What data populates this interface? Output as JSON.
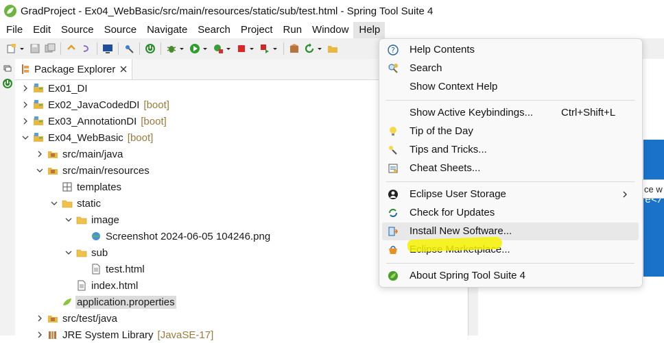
{
  "window": {
    "title": "GradProject - Ex04_WebBasic/src/main/resources/static/sub/test.html - Spring Tool Suite 4"
  },
  "menubar": {
    "items": [
      "File",
      "Edit",
      "Source",
      "Source",
      "Navigate",
      "Search",
      "Project",
      "Run",
      "Window",
      "Help"
    ],
    "active_index": 9
  },
  "explorer": {
    "tab_label": "Package Explorer",
    "rows": [
      {
        "label": "Ex01_DI",
        "deco": "",
        "level": 0,
        "chevron": "right",
        "icon": "project-icon"
      },
      {
        "label": "Ex02_JavaCodedDI",
        "deco": "[boot]",
        "level": 0,
        "chevron": "right",
        "icon": "project-icon"
      },
      {
        "label": "Ex03_AnnotationDI",
        "deco": "[boot]",
        "level": 0,
        "chevron": "right",
        "icon": "project-icon"
      },
      {
        "label": "Ex04_WebBasic",
        "deco": "[boot]",
        "level": 0,
        "chevron": "down",
        "icon": "project-icon"
      },
      {
        "label": "src/main/java",
        "deco": "",
        "level": 1,
        "chevron": "right",
        "icon": "source-folder-icon"
      },
      {
        "label": "src/main/resources",
        "deco": "",
        "level": 1,
        "chevron": "down",
        "icon": "source-folder-icon"
      },
      {
        "label": "templates",
        "deco": "",
        "level": 2,
        "chevron": "none",
        "icon": "package-icon"
      },
      {
        "label": "static",
        "deco": "",
        "level": 2,
        "chevron": "down",
        "icon": "folder-icon"
      },
      {
        "label": "image",
        "deco": "",
        "level": 3,
        "chevron": "down",
        "icon": "folder-icon"
      },
      {
        "label": "Screenshot 2024-06-05 104246.png",
        "deco": "",
        "level": 4,
        "chevron": "none",
        "icon": "image-file-icon"
      },
      {
        "label": "sub",
        "deco": "",
        "level": 3,
        "chevron": "down",
        "icon": "folder-icon"
      },
      {
        "label": "test.html",
        "deco": "",
        "level": 4,
        "chevron": "none",
        "icon": "html-file-icon"
      },
      {
        "label": "index.html",
        "deco": "",
        "level": 3,
        "chevron": "none",
        "icon": "html-file-icon"
      },
      {
        "label": "application.properties",
        "deco": "",
        "level": 2,
        "chevron": "none",
        "icon": "spring-leaf-icon",
        "selected": true
      },
      {
        "label": "src/test/java",
        "deco": "",
        "level": 1,
        "chevron": "right",
        "icon": "source-folder-icon"
      },
      {
        "label": "JRE System Library",
        "deco": "[JavaSE-17]",
        "level": 1,
        "chevron": "right",
        "icon": "library-icon"
      }
    ]
  },
  "editor": {
    "fragment_1": "e</t",
    "hint_fragment": "ce w"
  },
  "help_menu": {
    "items": [
      {
        "label": "Help Contents",
        "shortcut": "",
        "icon": "help-icon"
      },
      {
        "label": "Search",
        "shortcut": "",
        "icon": "search-help-icon"
      },
      {
        "label": "Show Context Help",
        "shortcut": "",
        "icon": ""
      },
      {
        "sep": true
      },
      {
        "label": "Show Active Keybindings...",
        "shortcut": "Ctrl+Shift+L",
        "icon": ""
      },
      {
        "label": "Tip of the Day",
        "shortcut": "",
        "icon": "lightbulb-icon"
      },
      {
        "label": "Tips and Tricks...",
        "shortcut": "",
        "icon": "tips-icon"
      },
      {
        "label": "Cheat Sheets...",
        "shortcut": "",
        "icon": "cheatsheet-icon"
      },
      {
        "sep": true
      },
      {
        "label": "Eclipse User Storage",
        "shortcut": "",
        "icon": "user-icon",
        "submenu": true
      },
      {
        "label": "Check for Updates",
        "shortcut": "",
        "icon": "update-icon"
      },
      {
        "label": "Install New Software...",
        "shortcut": "",
        "icon": "install-icon",
        "hover": true
      },
      {
        "label": "Eclipse Marketplace...",
        "shortcut": "",
        "icon": "marketplace-icon"
      },
      {
        "sep": true
      },
      {
        "label": "About Spring Tool Suite 4",
        "shortcut": "",
        "icon": "spring-icon"
      }
    ]
  },
  "colors": {
    "accent_blue": "#1a73c8",
    "highlight_yellow": "#f5f200",
    "spring_green": "#6db33f"
  }
}
